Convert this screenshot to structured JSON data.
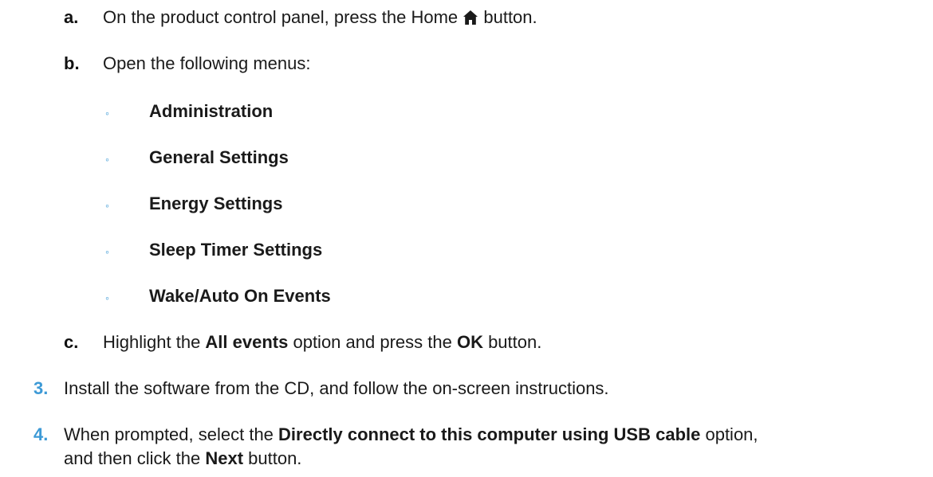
{
  "steps": {
    "a": {
      "marker": "a.",
      "text_before": "On the product control panel, press the Home ",
      "icon": "home-icon",
      "text_after": " button."
    },
    "b": {
      "marker": "b.",
      "text": "Open the following menus:",
      "menus": [
        "Administration",
        "General Settings",
        "Energy Settings",
        "Sleep Timer Settings",
        "Wake/Auto On Events"
      ]
    },
    "c": {
      "marker": "c.",
      "t1": "Highlight the ",
      "b1": "All events",
      "t2": " option and press the ",
      "b2": "OK",
      "t3": " button."
    },
    "s3": {
      "marker": "3.",
      "text": "Install the software from the CD, and follow the on-screen instructions."
    },
    "s4": {
      "marker": "4.",
      "t1": "When prompted, select the ",
      "b1": "Directly connect to this computer using USB cable",
      "t2": " option,",
      "t3": "and then click the ",
      "b2": "Next",
      "t4": " button."
    }
  },
  "colors": {
    "number_marker": "#3d9ad6",
    "bullet": "#3d9ad6",
    "text": "#1a1a1a"
  }
}
